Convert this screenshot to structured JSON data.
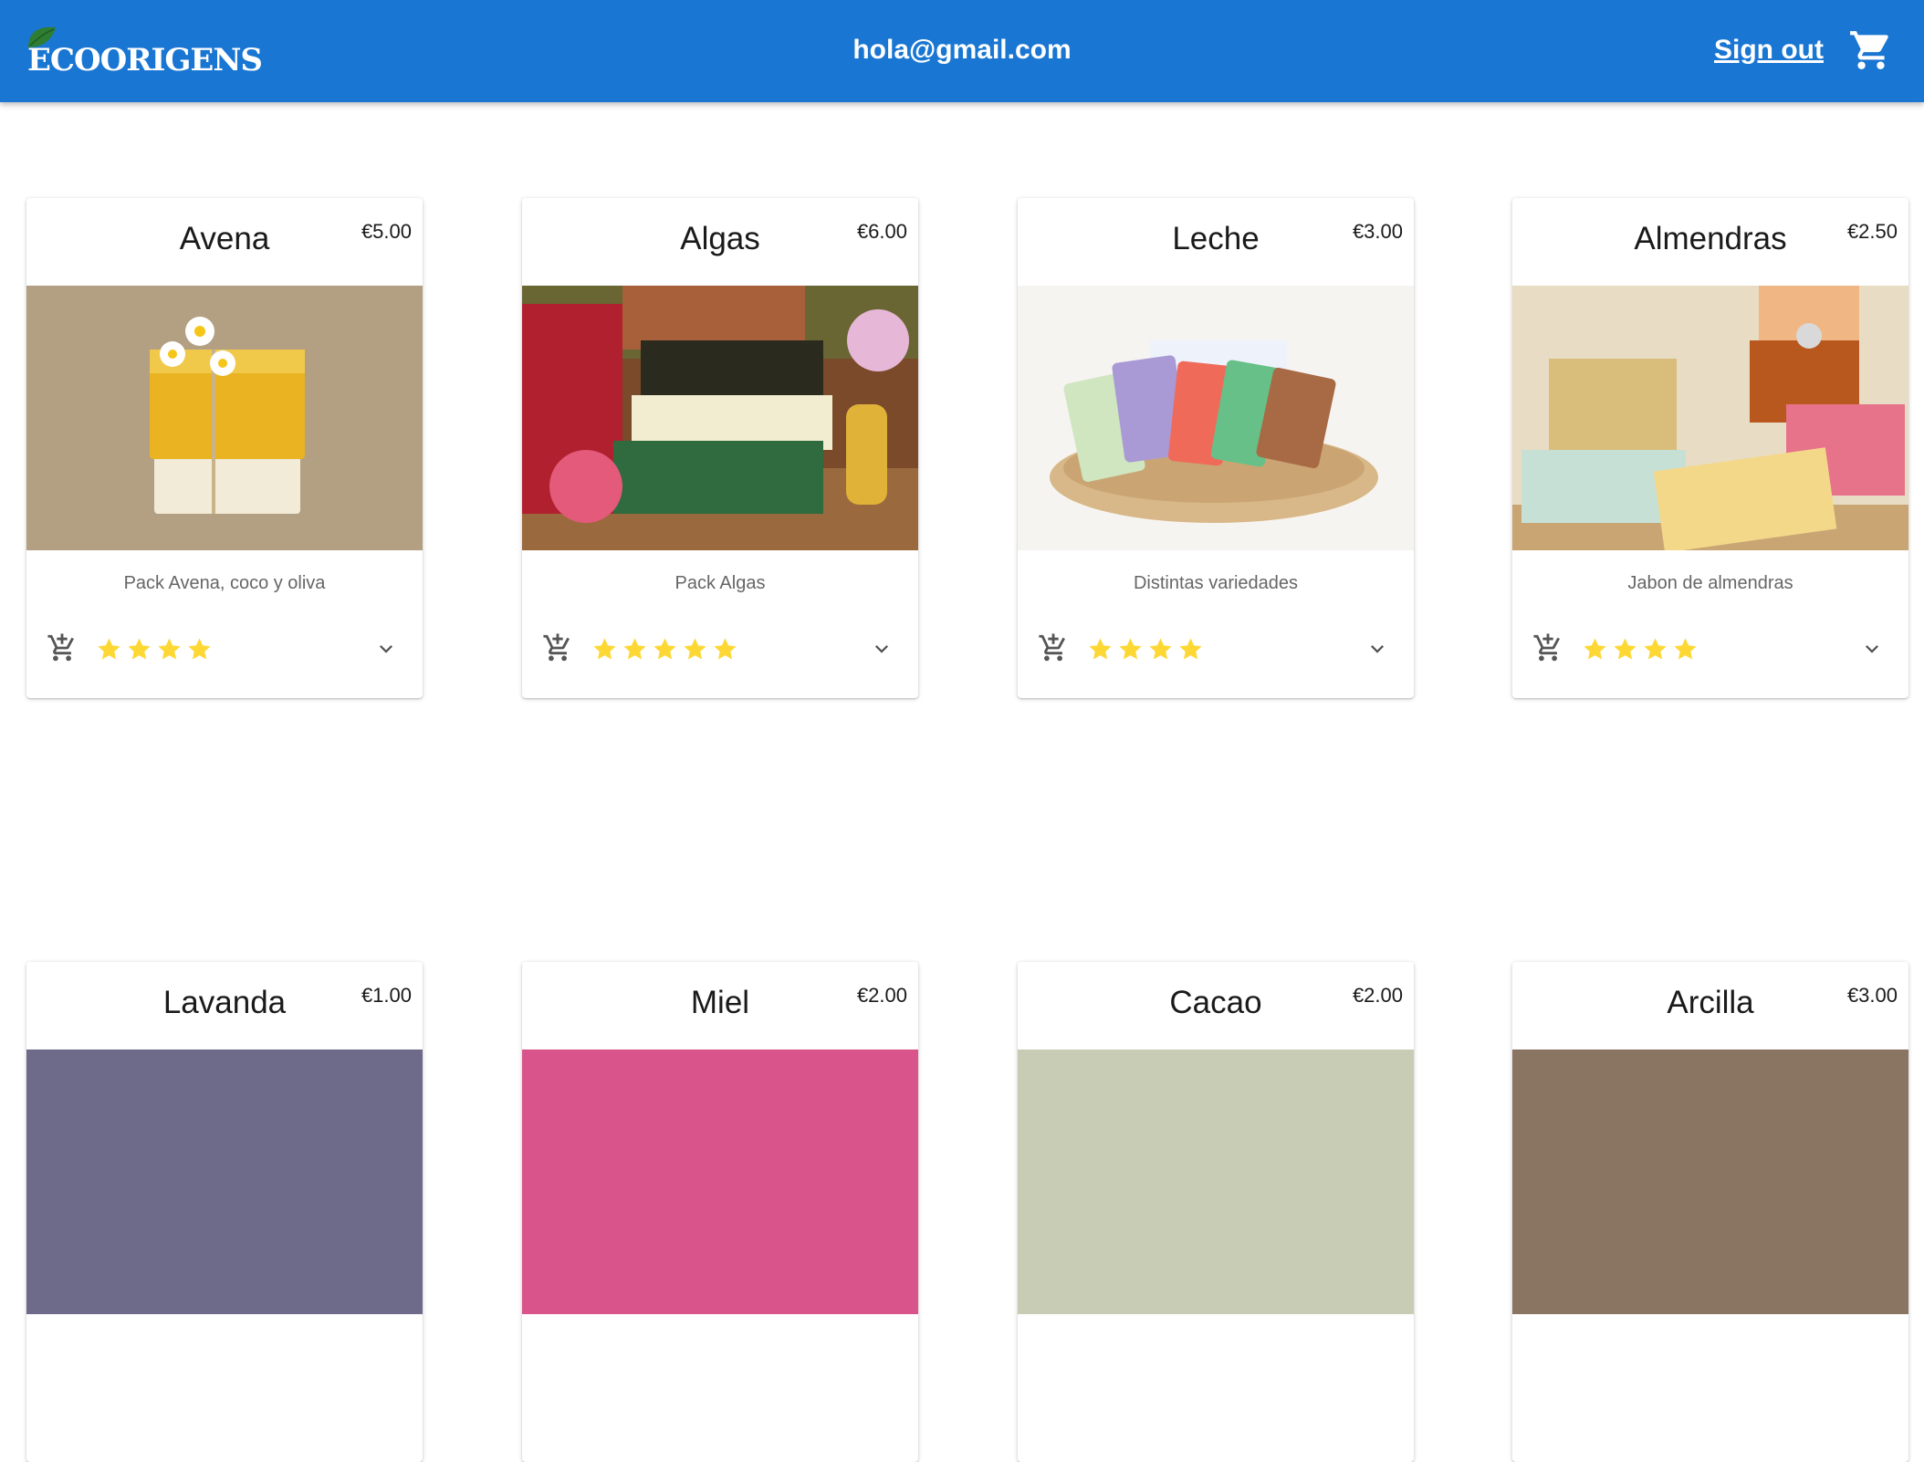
{
  "header": {
    "logo_text": "ECOORIGENS",
    "user_email": "hola@gmail.com",
    "signout_label": "Sign out",
    "cart_icon": "shopping-cart-icon",
    "color": "#1976d2"
  },
  "products": [
    {
      "name": "Avena",
      "price": "€5.00",
      "description": "Pack Avena, coco y oliva",
      "rating": 4
    },
    {
      "name": "Algas",
      "price": "€6.00",
      "description": "Pack Algas",
      "rating": 5
    },
    {
      "name": "Leche",
      "price": "€3.00",
      "description": "Distintas variedades",
      "rating": 4
    },
    {
      "name": "Almendras",
      "price": "€2.50",
      "description": "Jabon de almendras",
      "rating": 4
    },
    {
      "name": "Lavanda",
      "price": "€1.00"
    },
    {
      "name": "Miel",
      "price": "€2.00"
    },
    {
      "name": "Cacao",
      "price": "€2.00"
    },
    {
      "name": "Arcilla",
      "price": "€3.00"
    }
  ],
  "icons": {
    "add_to_cart": "add-shopping-cart-icon",
    "rating": "star-icon",
    "expand": "chevron-down-icon"
  },
  "colors": {
    "star": "#fdd835"
  }
}
